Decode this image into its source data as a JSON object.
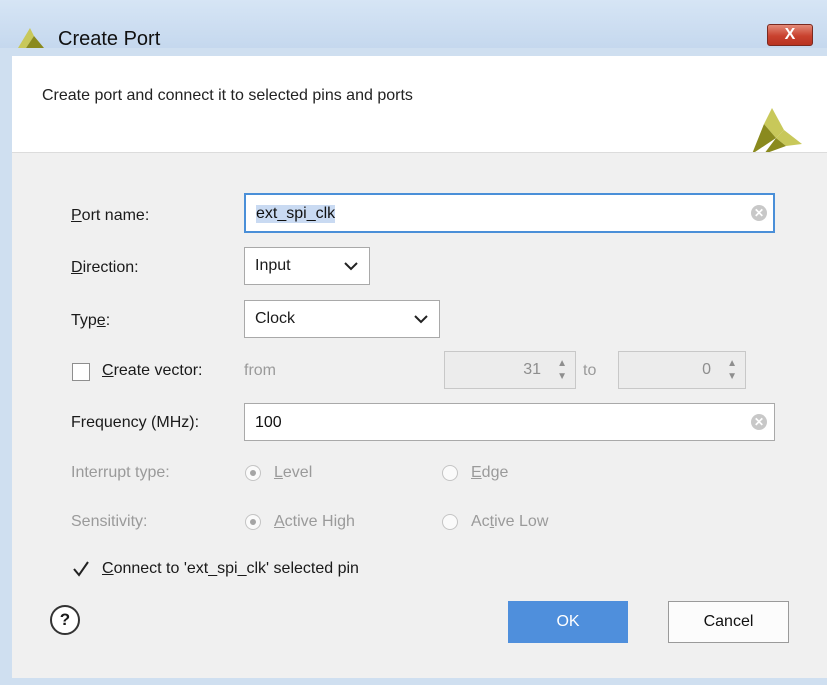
{
  "window": {
    "title": "Create Port",
    "close_label": "X"
  },
  "header": {
    "description": "Create port and connect it to selected pins and ports"
  },
  "form": {
    "port_name": {
      "label_first": "P",
      "label_rest": "ort name:",
      "value": "ext_spi_clk"
    },
    "direction": {
      "label_first": "D",
      "label_rest": "irection:",
      "value": "Input"
    },
    "type": {
      "label_first": "Typ",
      "label_u": "e",
      "label_rest": ":",
      "value": "Clock"
    },
    "create_vector": {
      "checked": false,
      "label_first": "C",
      "label_rest": "reate vector:",
      "from_label": "from",
      "from_value": "31",
      "to_label": "to",
      "to_value": "0"
    },
    "frequency": {
      "label": "Frequency (MHz):",
      "value": "100"
    },
    "interrupt_type": {
      "label": "Interrupt type:",
      "option_level_u": "L",
      "option_level_rest": "evel",
      "option_edge_u": "E",
      "option_edge_rest": "dge",
      "selected": "Level"
    },
    "sensitivity": {
      "label": "Sensitivity:",
      "option_high_u": "A",
      "option_high_rest": "ctive High",
      "option_low_pre": "Ac",
      "option_low_u": "t",
      "option_low_rest": "ive Low",
      "selected": "Active High"
    },
    "connect": {
      "checked": true,
      "label_first": "C",
      "label_rest": "onnect to 'ext_spi_clk' selected  pin"
    }
  },
  "footer": {
    "help_label": "?",
    "ok_label": "OK",
    "cancel_label": "Cancel"
  },
  "colors": {
    "accent": "#4f8fdc",
    "close": "#c9422f",
    "logo_light": "#c8c85a",
    "logo_dark": "#8a8a1e"
  }
}
